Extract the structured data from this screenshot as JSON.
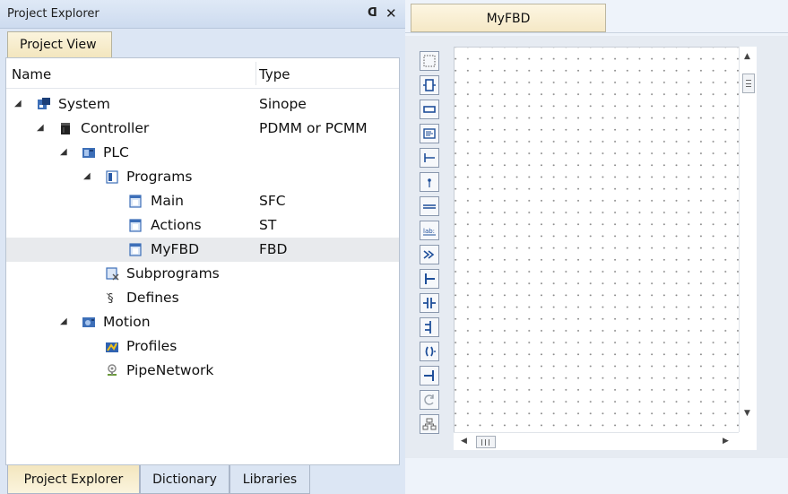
{
  "explorer": {
    "title": "Project Explorer",
    "float_icon": "float-window-icon",
    "close_icon": "close-icon",
    "view_tab": "Project View",
    "columns": {
      "name": "Name",
      "type": "Type"
    },
    "tree": [
      {
        "label": "System",
        "type": "Sinope",
        "icon": "system-icon",
        "expanded": true
      },
      {
        "label": "Controller",
        "type": "PDMM or PCMM",
        "icon": "controller-icon",
        "expanded": true
      },
      {
        "label": "PLC",
        "type": "",
        "icon": "plc-icon",
        "expanded": true
      },
      {
        "label": "Programs",
        "type": "",
        "icon": "programs-folder-icon",
        "expanded": true
      },
      {
        "label": "Main",
        "type": "SFC",
        "icon": "program-file-icon"
      },
      {
        "label": "Actions",
        "type": "ST",
        "icon": "program-file-icon"
      },
      {
        "label": "MyFBD",
        "type": "FBD",
        "icon": "program-file-icon",
        "selected": true
      },
      {
        "label": "Subprograms",
        "type": "",
        "icon": "subprograms-icon"
      },
      {
        "label": "Defines",
        "type": "",
        "icon": "defines-icon"
      },
      {
        "label": "Motion",
        "type": "",
        "icon": "motion-icon",
        "expanded": true
      },
      {
        "label": "Profiles",
        "type": "",
        "icon": "profiles-icon"
      },
      {
        "label": "PipeNetwork",
        "type": "",
        "icon": "pipenetwork-icon"
      }
    ],
    "bottom_tabs": [
      "Project Explorer",
      "Dictionary",
      "Libraries"
    ]
  },
  "editor": {
    "tab": "MyFBD",
    "tools": [
      "selection-tool-icon",
      "function-block-tool-icon",
      "variable-tool-icon",
      "comment-tool-icon",
      "horizontal-line-tool-icon",
      "connection-point-tool-icon",
      "vertical-line-tool-icon",
      "label-tool-icon",
      "jump-tool-icon",
      "left-rail-tool-icon",
      "contact-tool-icon",
      "vertical-contact-tool-icon",
      "coil-tool-icon",
      "right-rail-tool-icon",
      "return-tool-icon",
      "network-tool-icon"
    ]
  },
  "colors": {
    "accent_tab": "#f5e8c6",
    "panel_bg": "#dce6f4",
    "selection": "#e8eaed"
  }
}
